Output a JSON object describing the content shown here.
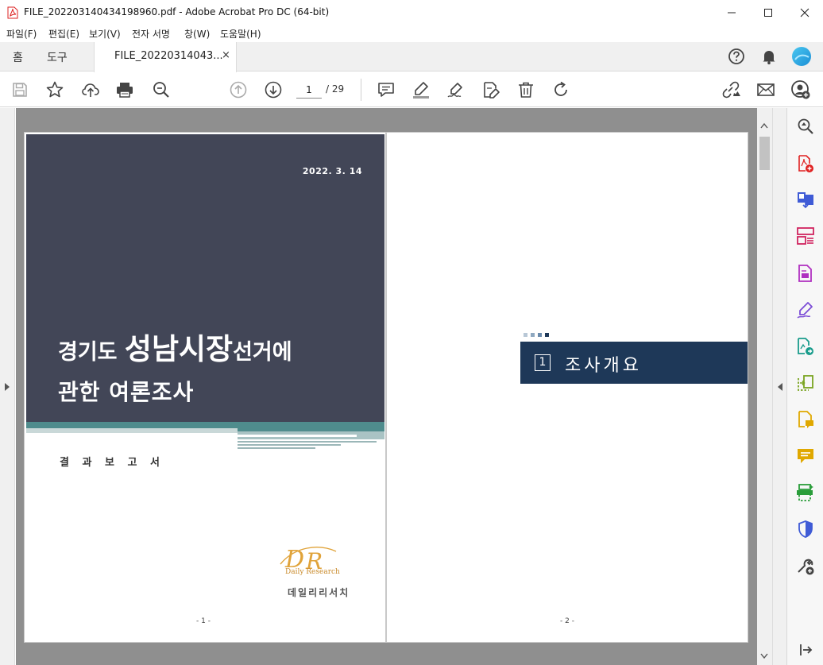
{
  "window": {
    "title": "FILE_202203140434198960.pdf - Adobe Acrobat Pro DC (64-bit)"
  },
  "menu": [
    "파일(F)",
    "편집(E)",
    "보기(V)",
    "전자 서명",
    "창(W)",
    "도움말(H)"
  ],
  "tabs": {
    "home": "홈",
    "tools": "도구",
    "document": "FILE_20220314043...",
    "close": "×"
  },
  "toolbar": {
    "page_current": "1",
    "page_total": "/ 29"
  },
  "page1": {
    "date": "2022. 3. 14",
    "title_a": "경기도 ",
    "title_b": "성남시장",
    "title_c": "선거에",
    "title_line2": "관한 여론조사",
    "report_label": "결 과 보 고 서",
    "logo_text": "Daily Research",
    "company": "데일리리서치",
    "page_number": "- 1 -"
  },
  "page2": {
    "section_number": "1",
    "section_title": "조사개요",
    "page_number": "- 2 -"
  },
  "colors": {
    "cover_bg": "#424657",
    "cover_teal": "#4f8c8d",
    "banner_bg": "#1e3858",
    "logo_orange": "#e0a33a",
    "acrobat_red": "#e02020"
  },
  "icons": {
    "left_tools": [
      "save-icon",
      "star-icon",
      "cloud-upload-icon",
      "print-icon",
      "zoom-icon"
    ],
    "nav": [
      "page-up-icon",
      "page-down-icon"
    ],
    "annotate": [
      "comment-icon",
      "highlight-icon",
      "sign-icon",
      "fill-sign-icon",
      "delete-icon",
      "rotate-icon"
    ],
    "share": [
      "share-link-icon",
      "email-icon",
      "add-user-icon"
    ],
    "right_panel": [
      "search-zoom-icon",
      "create-pdf-icon",
      "combine-files-icon",
      "organize-pages-icon",
      "export-pdf-icon",
      "edit-pdf-icon",
      "fill-sign-icon",
      "send-for-review-icon",
      "comment-icon",
      "scan-icon",
      "protect-icon",
      "more-tools-icon",
      "collapse-panel-icon"
    ]
  }
}
